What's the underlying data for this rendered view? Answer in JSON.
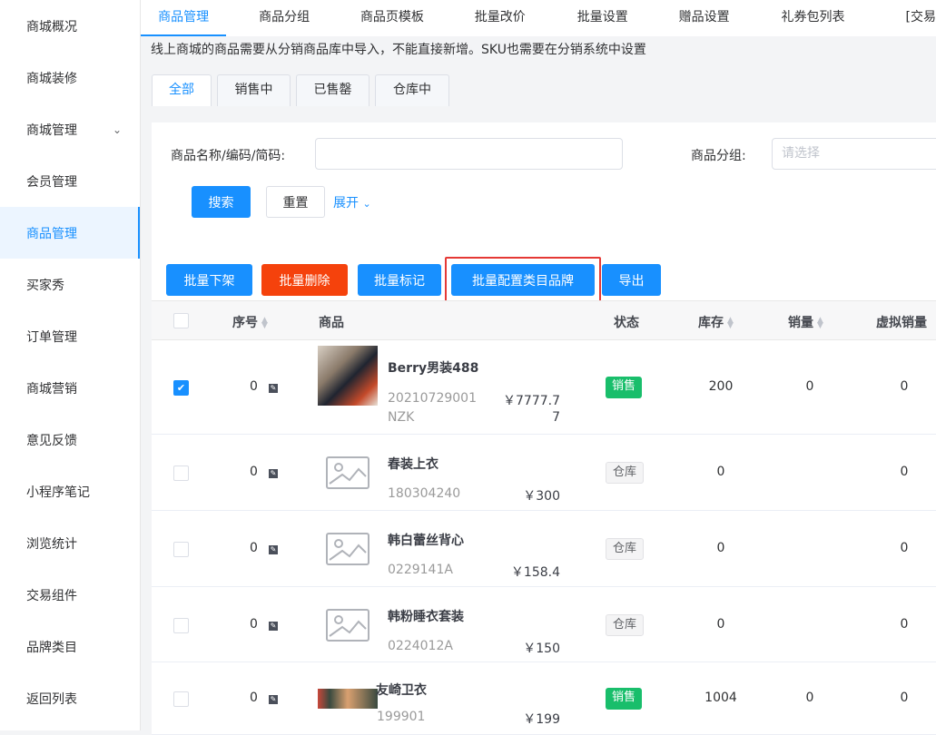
{
  "sidebar": {
    "items": [
      {
        "label": "商城概况"
      },
      {
        "label": "商城装修"
      },
      {
        "label": "商城管理"
      },
      {
        "label": "会员管理"
      },
      {
        "label": "商品管理"
      },
      {
        "label": "买家秀"
      },
      {
        "label": "订单管理"
      },
      {
        "label": "商城营销"
      },
      {
        "label": "意见反馈"
      },
      {
        "label": "小程序笔记"
      },
      {
        "label": "浏览统计"
      },
      {
        "label": "交易组件"
      },
      {
        "label": "品牌类目"
      },
      {
        "label": "返回列表"
      }
    ]
  },
  "topnav": {
    "tabs": [
      {
        "label": "商品管理"
      },
      {
        "label": "商品分组"
      },
      {
        "label": "商品页模板"
      },
      {
        "label": "批量改价"
      },
      {
        "label": "批量设置"
      },
      {
        "label": "赠品设置"
      },
      {
        "label": "礼券包列表"
      },
      {
        "label": "[交易"
      }
    ]
  },
  "notice": "线上商城的商品需要从分销商品库中导入，不能直接新增。SKU也需要在分销系统中设置",
  "subtabs": [
    {
      "label": "全部"
    },
    {
      "label": "销售中"
    },
    {
      "label": "已售罄"
    },
    {
      "label": "仓库中"
    }
  ],
  "filter": {
    "name_label": "商品名称/编码/简码:",
    "name_value": "",
    "group_label": "商品分组:",
    "group_placeholder": "请选择",
    "search": "搜索",
    "reset": "重置",
    "expand": "展开"
  },
  "actions": {
    "offshelf": "批量下架",
    "delete": "批量删除",
    "mark": "批量标记",
    "config_brand": "批量配置类目品牌",
    "export": "导出"
  },
  "table": {
    "headers": {
      "seq": "序号",
      "product": "商品",
      "status": "状态",
      "stock": "库存",
      "sales": "销量",
      "virtual_sales": "虚拟销量"
    },
    "rows": [
      {
        "checked": true,
        "seq": "0",
        "name": "Berry男装488",
        "code": "20210729001",
        "code2": "NZK",
        "price": "￥7777.7",
        "price2": "7",
        "status": "销售",
        "stock": "200",
        "sales": "0",
        "virtual": "0",
        "image": "photo"
      },
      {
        "checked": false,
        "seq": "0",
        "name": "春装上衣",
        "code": "180304240",
        "price": "￥300",
        "status": "仓库",
        "stock": "0",
        "sales": "",
        "virtual": "0",
        "image": "placeholder"
      },
      {
        "checked": false,
        "seq": "0",
        "name": "韩白蕾丝背心",
        "code": "0229141A",
        "price": "￥158.4",
        "status": "仓库",
        "stock": "0",
        "sales": "",
        "virtual": "0",
        "image": "placeholder"
      },
      {
        "checked": false,
        "seq": "0",
        "name": "韩粉睡衣套装",
        "code": "0224012A",
        "price": "￥150",
        "status": "仓库",
        "stock": "0",
        "sales": "",
        "virtual": "0",
        "image": "placeholder"
      },
      {
        "checked": false,
        "seq": "0",
        "name": "友崎卫衣",
        "code": "199901",
        "price": "￥199",
        "status": "销售",
        "stock": "1004",
        "sales": "0",
        "virtual": "0",
        "image": "photo"
      }
    ]
  },
  "colors": {
    "primary": "#1890ff",
    "danger": "#f5420c",
    "success": "#19be6b",
    "highlight": "#e53935"
  }
}
